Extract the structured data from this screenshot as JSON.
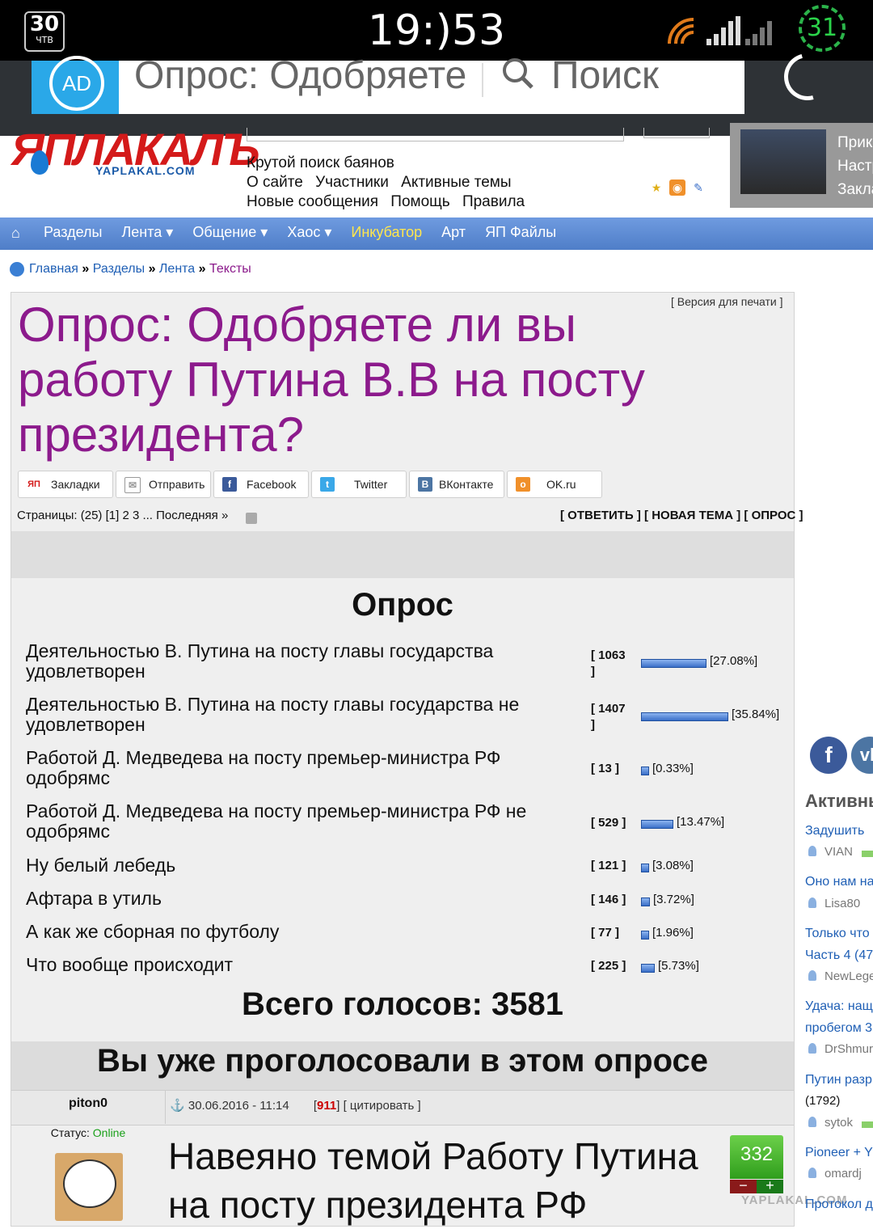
{
  "status_bar": {
    "channel_number": "30",
    "channel_name": "ЧТВ",
    "time": "19:)53",
    "battery": "31"
  },
  "browser": {
    "url_text": "Опрос: Одобряете",
    "search_label": "Поиск",
    "ad_icon": "AD"
  },
  "site": {
    "logo_main": "ЯПЛАКАЛЪ",
    "logo_sub": "YAPLAKAL.COM",
    "search_caption": "Крутой поиск баянов",
    "links_row1": [
      "О сайте",
      "Участники",
      "Активные темы"
    ],
    "links_row2": [
      "Новые сообщения",
      "Помощь",
      "Правила"
    ],
    "banner_lines": [
      "Прико",
      "Настр",
      "Закла"
    ]
  },
  "nav": {
    "items": [
      "Разделы",
      "Лента ▾",
      "Общение ▾",
      "Хаос ▾",
      "Инкубатор",
      "Арт",
      "ЯП Файлы"
    ],
    "highlight_color": "#ffe64d"
  },
  "breadcrumb": {
    "items": [
      "Главная",
      "Разделы",
      "Лента",
      "Тексты"
    ],
    "sep": "»"
  },
  "topic": {
    "print_link": "[ Версия для печати ]",
    "title": "Опрос: Одобряете ли вы работу Путина В.В на посту президента?",
    "title_color": "#8c1a8c"
  },
  "share": {
    "items": [
      {
        "label": "Закладки",
        "icon": "ЯП"
      },
      {
        "label": "Отправить",
        "icon": "envelope-icon"
      },
      {
        "label": "Facebook",
        "icon": "f"
      },
      {
        "label": "Twitter",
        "icon": "t"
      },
      {
        "label": "ВКонтакте",
        "icon": "В"
      },
      {
        "label": "OK.ru",
        "icon": "ok"
      }
    ]
  },
  "pagination": {
    "text": "Страницы: (25) [1] 2 3 ... Последняя »",
    "actions": "[ ОТВЕТИТЬ ] [ НОВАЯ ТЕМА ] [ ОПРОС ]"
  },
  "poll": {
    "heading": "Опрос",
    "options": [
      {
        "question": "Деятельностью В. Путина на посту главы государства удовлетворен",
        "votes": "[ 1063 ]",
        "percent": "[27.08%]",
        "share": 0.2708
      },
      {
        "question": "Деятельностью В. Путина на посту главы государства не удовлетворен",
        "votes": "[ 1407 ]",
        "percent": "[35.84%]",
        "share": 0.3584
      },
      {
        "question": "Работой Д. Медведева на посту премьер-министра РФ одобрямс",
        "votes": "[ 13 ]",
        "percent": "[0.33%]",
        "share": 0.0033
      },
      {
        "question": "Работой Д. Медведева на посту премьер-министра РФ не одобрямс",
        "votes": "[ 529 ]",
        "percent": "[13.47%]",
        "share": 0.1347
      },
      {
        "question": "Ну белый лебедь",
        "votes": "[ 121 ]",
        "percent": "[3.08%]",
        "share": 0.0308
      },
      {
        "question": "Афтара в утиль",
        "votes": "[ 146 ]",
        "percent": "[3.72%]",
        "share": 0.0372
      },
      {
        "question": "А как же сборная по футболу",
        "votes": "[ 77 ]",
        "percent": "[1.96%]",
        "share": 0.0196
      },
      {
        "question": "Что вообще происходит",
        "votes": "[ 225 ]",
        "percent": "[5.73%]",
        "share": 0.0573
      }
    ],
    "total": "Всего голосов: 3581",
    "voted_message": "Вы уже проголосовали в этом опросе"
  },
  "post": {
    "author": "piton0",
    "status_label": "Статус:",
    "status_value": "Online",
    "date": "30.06.2016 - 11:14",
    "post_num_open": "[",
    "post_num": "911",
    "post_num_close": "]",
    "quote": "[ цитировать ]",
    "text": "Навеяно темой Работу Путина на посту президента РФ",
    "rating": "332",
    "minus": "−",
    "plus": "+",
    "watermark": "YAPLAKAL.COM"
  },
  "sidebar": {
    "heading": "Активны",
    "entries": [
      {
        "title": "Задушить",
        "user": "VIAN"
      },
      {
        "title": "Оно нам на",
        "user": "Lisa80"
      },
      {
        "title": "Только что",
        "title2": "Часть 4 (47",
        "user": "NewLege"
      },
      {
        "title": "Удача: нащ",
        "title2": "пробегом 3",
        "user": "DrShmur"
      },
      {
        "title": "Путин разр",
        "extra": "(1792)",
        "user": "sytok"
      },
      {
        "title": "Pioneer + Y",
        "user": "omardj"
      },
      {
        "title": "Протокол д"
      }
    ]
  }
}
